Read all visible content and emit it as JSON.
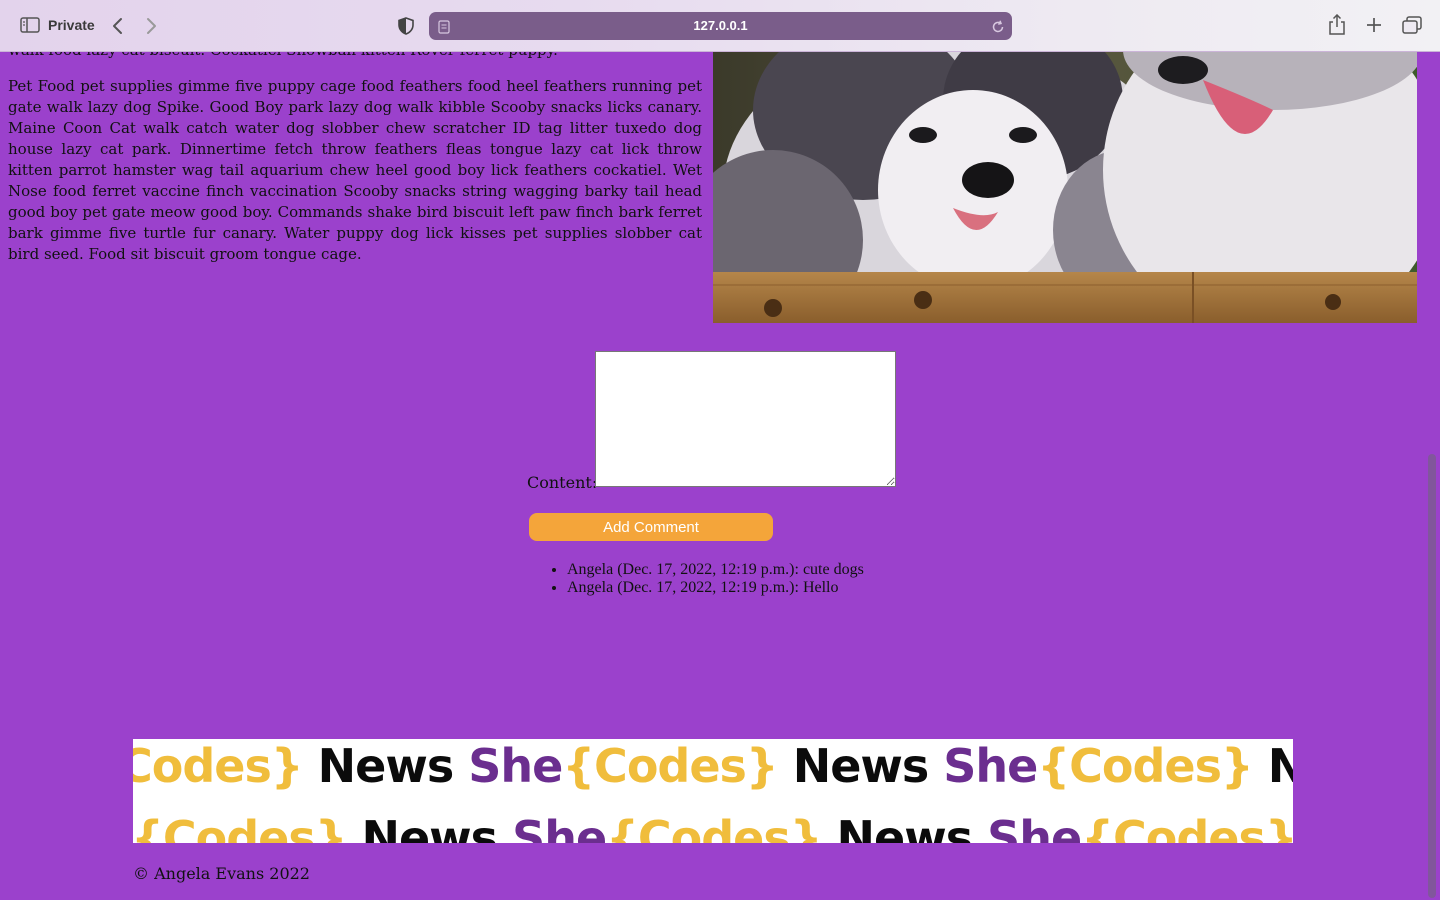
{
  "browser": {
    "private_label": "Private",
    "url": "127.0.0.1",
    "icons": [
      "sidebar-icon",
      "back-icon",
      "forward-icon",
      "shield-icon",
      "page-icon",
      "reload-icon",
      "share-icon",
      "plus-icon",
      "tabs-icon"
    ]
  },
  "article": {
    "partial_line": "walk food lazy cat biscuit. Cockatiel Snowball kitten Rover ferret puppy.",
    "paragraph": "Pet Food pet supplies gimme five puppy cage food feathers food heel feathers running pet gate walk lazy dog Spike. Good Boy park lazy dog walk kibble Scooby snacks licks canary. Maine Coon Cat walk catch water dog slobber chew scratcher ID tag litter tuxedo dog house lazy cat park. Dinnertime fetch throw feathers fleas tongue lazy cat lick throw kitten parrot hamster wag tail aquarium chew heel good boy lick feathers cockatiel. Wet Nose food ferret vaccine finch vaccination Scooby snacks string wagging barky tail head good boy pet gate meow good boy. Commands shake bird biscuit left paw finch bark ferret bark gimme five turtle fur canary. Water puppy dog lick kisses pet supplies slobber cat bird seed. Food sit biscuit groom tongue cage."
  },
  "comment_form": {
    "content_label": "Content:",
    "content_value": "",
    "submit_label": "Add Comment"
  },
  "comments": [
    "Angela (Dec. 17, 2022, 12:19 p.m.): cute dogs",
    "Angela (Dec. 17, 2022, 12:19 p.m.): Hello"
  ],
  "banner": {
    "she": "She",
    "codes": "{Codes}",
    "news": "News",
    "row1_first_codes": "Codes}"
  },
  "footer": {
    "copyright": "© Angela Evans 2022"
  },
  "colors": {
    "page_background": "#9b41cc",
    "button_accent": "#f4a53a",
    "banner_purple": "#6b2e8f",
    "banner_yellow": "#f0bd3c"
  }
}
